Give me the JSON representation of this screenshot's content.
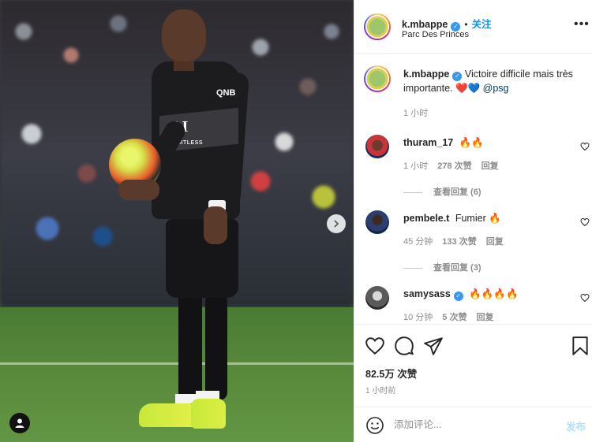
{
  "post": {
    "username": "k.mbappe",
    "follow_label": "关注",
    "location": "Parc Des Princes",
    "more_label": "•••",
    "sponsor_text": "QNB",
    "shirt_logo": "AI",
    "shirt_text": "LIMITLESS"
  },
  "caption": {
    "username": "k.mbappe",
    "text": "Victoire difficile mais très importante.",
    "emojis": "❤️💙",
    "mention": "@psg",
    "time": "1 小时"
  },
  "comments": [
    {
      "username": "thuram_17",
      "verified": false,
      "text": "🔥🔥",
      "time": "1 小时",
      "likes": "278 次赞",
      "reply_label": "回复",
      "view_replies": "查看回复 (6)"
    },
    {
      "username": "pembele.t",
      "verified": false,
      "text": "Fumier 🔥",
      "time": "45 分钟",
      "likes": "133 次赞",
      "reply_label": "回复",
      "view_replies": "查看回复 (3)"
    },
    {
      "username": "samysass",
      "verified": true,
      "text": "🔥🔥🔥🔥",
      "time": "10 分钟",
      "likes": "5 次赞",
      "reply_label": "回复"
    }
  ],
  "stats": {
    "likes": "82.5万 次赞",
    "time": "1 小时前"
  },
  "composer": {
    "placeholder": "添加评论...",
    "post_label": "发布"
  },
  "icons": {
    "verified": "verified-badge-icon",
    "like": "heart-icon",
    "comment": "comment-icon",
    "share": "share-icon",
    "save": "bookmark-icon",
    "emoji": "emoji-icon",
    "next": "chevron-right-icon",
    "tag": "user-tag-icon"
  },
  "colors": {
    "link": "#0095f6",
    "verified": "#3897f0",
    "muted": "#8e8e8e",
    "post_disabled": "#b2dffc",
    "heart": "#ed4956"
  }
}
